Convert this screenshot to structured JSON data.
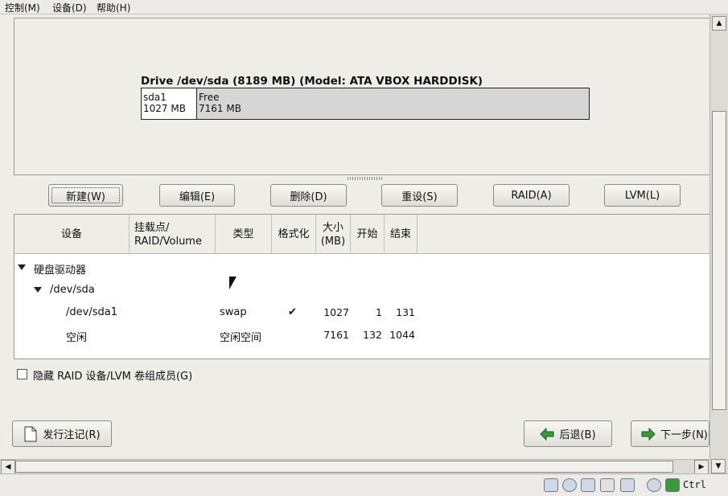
{
  "menubar": {
    "control": "控制(M)",
    "devices": "设备(D)",
    "help": "帮助(H)"
  },
  "drive": {
    "title": "Drive /dev/sda (8189 MB) (Model: ATA VBOX HARDDISK)",
    "segments": [
      {
        "name": "sda1",
        "size": "1027 MB"
      },
      {
        "name": "Free",
        "size": "7161 MB"
      }
    ]
  },
  "buttons": {
    "new": "新建(W)",
    "edit": "编辑(E)",
    "delete": "删除(D)",
    "reset": "重设(S)",
    "raid": "RAID(A)",
    "lvm": "LVM(L)"
  },
  "table": {
    "headers": {
      "device": "设备",
      "mount_line1": "挂载点/",
      "mount_line2": "RAID/Volume",
      "type": "类型",
      "format": "格式化",
      "size_line1": "大小",
      "size_line2": "(MB)",
      "start": "开始",
      "end": "结束"
    },
    "rows": [
      {
        "device": "硬盘驱动器"
      },
      {
        "device": "/dev/sda"
      },
      {
        "device": "/dev/sda1",
        "type": "swap",
        "format": "✔",
        "size": "1027",
        "start": "1",
        "end": "131"
      },
      {
        "device": "空闲",
        "type": "空闲空间",
        "size": "7161",
        "start": "132",
        "end": "1044"
      }
    ]
  },
  "hide_raid_label": "隐藏 RAID 设备/LVM 卷组成员(G)",
  "release_notes": "发行注记(R)",
  "back": "后退(B)",
  "next": "下一步(N)",
  "status": {
    "host_key": "Ctrl"
  }
}
